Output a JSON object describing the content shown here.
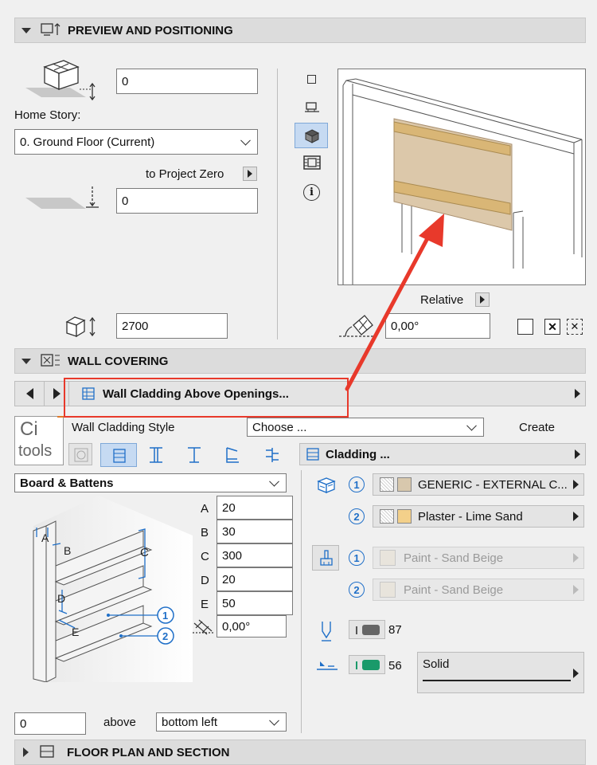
{
  "preview": {
    "header": "PREVIEW AND POSITIONING",
    "offset_value": "0",
    "home_story_label": "Home Story:",
    "home_story_value": "0. Ground Floor (Current)",
    "to_project_zero_label": "to Project Zero",
    "project_zero_value": "0",
    "height_value": "2700",
    "relative_label": "Relative",
    "angle_value": "0,00°"
  },
  "wall_covering": {
    "header": "WALL COVERING",
    "favorite_name": "Wall Cladding Above Openings...",
    "logo_line1": "Ci",
    "logo_line2": "tools",
    "style_label": "Wall Cladding Style",
    "style_choose": "Choose ...",
    "create_label": "Create",
    "cladding_label": "Cladding ...",
    "type_value": "Board & Battens",
    "dims": [
      {
        "label": "A",
        "value": "20"
      },
      {
        "label": "B",
        "value": "30"
      },
      {
        "label": "C",
        "value": "300"
      },
      {
        "label": "D",
        "value": "20"
      },
      {
        "label": "E",
        "value": "50"
      }
    ],
    "rotation_value": "0,00°",
    "diagram_labels": {
      "a": "A",
      "b": "B",
      "c": "C",
      "d": "D",
      "e": "E",
      "one": "1",
      "two": "2"
    },
    "materials": [
      {
        "num": "1",
        "name": "GENERIC - EXTERNAL C...",
        "color": "#d8c8ad",
        "enabled": true
      },
      {
        "num": "2",
        "name": "Plaster - Lime Sand",
        "color": "#f3d08a",
        "enabled": true
      }
    ],
    "paints": [
      {
        "num": "1",
        "name": "Paint - Sand Beige",
        "enabled": false
      },
      {
        "num": "2",
        "name": "Paint - Sand Beige",
        "enabled": false
      }
    ],
    "pen1_value": "87",
    "pen2_value": "56",
    "line_type": "Solid",
    "offset_value": "0",
    "above_label": "above",
    "anchor_value": "bottom left"
  },
  "floor_plan": {
    "header": "FLOOR PLAN AND SECTION"
  },
  "colors": {
    "accent_blue": "#1f6fc8",
    "annotation_red": "#e8392b",
    "pen_green": "#1a9a6a"
  }
}
